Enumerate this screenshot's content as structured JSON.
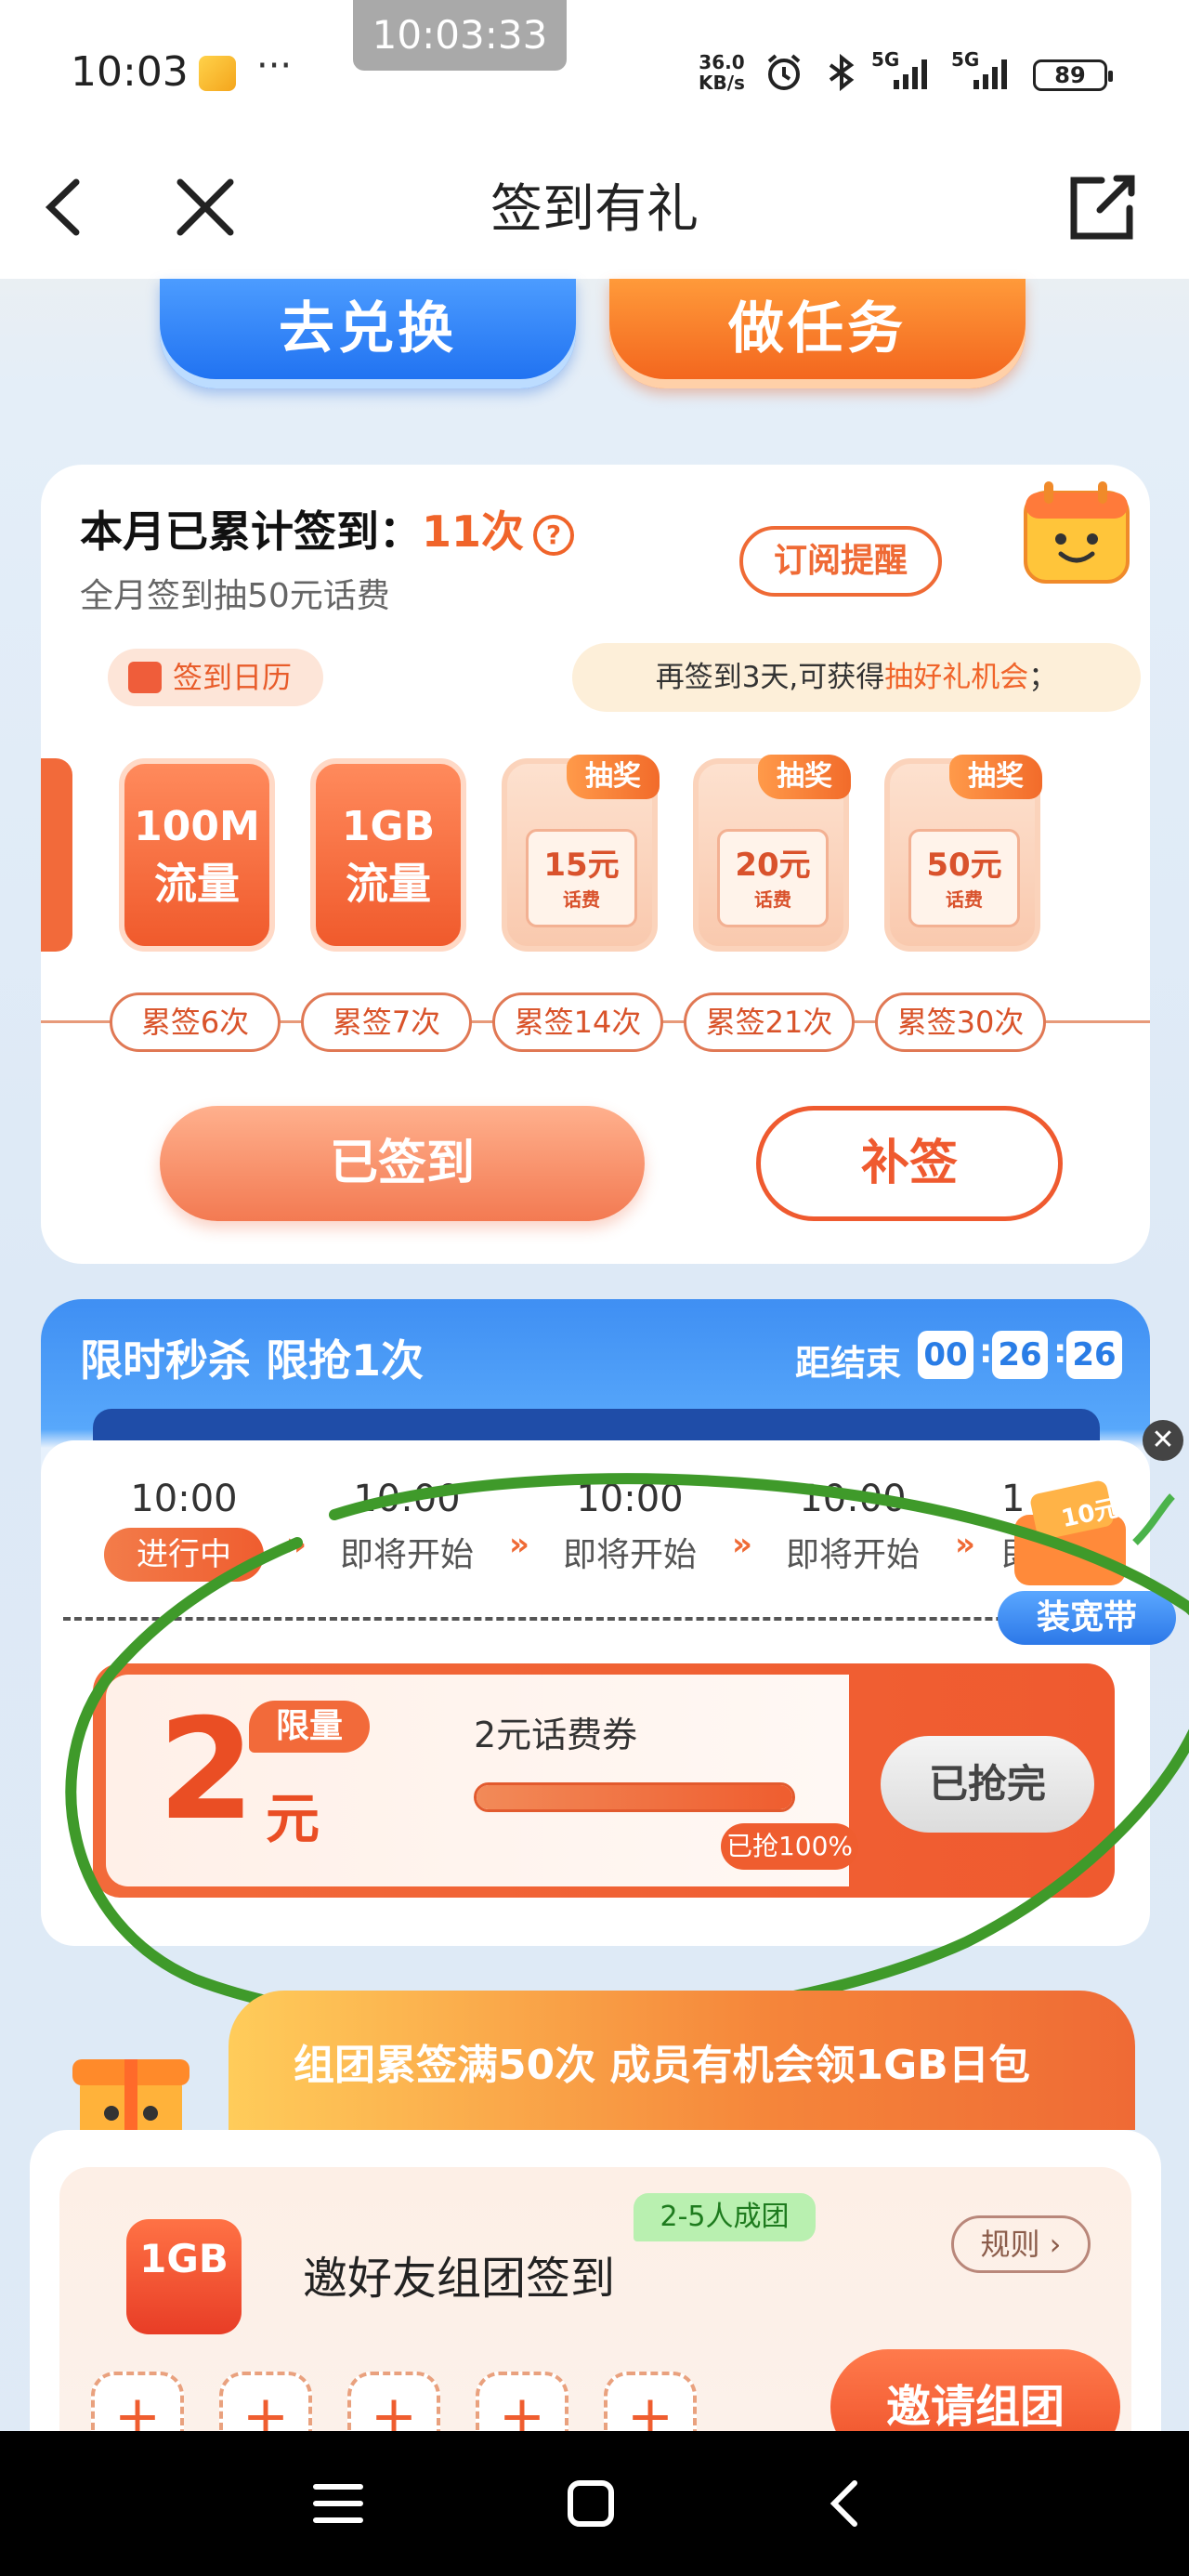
{
  "status_bar": {
    "time": "10:03",
    "more": "···",
    "recording_timer": "10:03:33",
    "net_speed_value": "36.0",
    "net_speed_unit": "KB/s",
    "signal_1": "5G",
    "signal_2": "5G",
    "battery": "89"
  },
  "header": {
    "title": "签到有礼"
  },
  "top_actions": {
    "exchange_label": "去兑换",
    "task_label": "做任务"
  },
  "checkin": {
    "title_prefix": "本月已累计签到：",
    "count": "11次",
    "help_glyph": "?",
    "subtitle": "全月签到抽50元话费",
    "subscribe_label": "订阅提醒",
    "calendar_label": "签到日历",
    "hint_prefix": "再签到3天,可获得",
    "hint_highlight": "抽好礼机会",
    "hint_suffix": "；",
    "rewards": [
      {
        "line1": "100M",
        "line2": "流量",
        "day": "累签6次"
      },
      {
        "line1": "1GB",
        "line2": "流量",
        "day": "累签7次"
      },
      {
        "badge": "抽奖",
        "value": "15元",
        "unit": "话费",
        "day": "累签14次"
      },
      {
        "badge": "抽奖",
        "value": "20元",
        "unit": "话费",
        "day": "累签21次"
      },
      {
        "badge": "抽奖",
        "value": "50元",
        "unit": "话费",
        "day": "累签30次"
      }
    ],
    "signed_label": "已签到",
    "makeup_label": "补签"
  },
  "flash_sale": {
    "title": "限时秒杀  限抢1次",
    "ends_label": "距结束",
    "countdown": [
      "00",
      "26",
      "26"
    ],
    "close_glyph": "✕",
    "slots": [
      {
        "time": "10:00",
        "status": "进行中"
      },
      {
        "time": "10:00",
        "status": "即将开始"
      },
      {
        "time": "10:00",
        "status": "即将开始"
      },
      {
        "time": "10:00",
        "status": "即将开始"
      },
      {
        "time": "1",
        "status": "即"
      }
    ],
    "arrow_glyph": "»",
    "coupon": {
      "amount": "2",
      "unit": "元",
      "limit_tag": "限量",
      "name": "2元话费券",
      "progress": 1.0,
      "progress_label": "已抢100%",
      "button_label": "已抢完"
    },
    "broadband_label": "装宽带",
    "broadband_price": "10元"
  },
  "group": {
    "banner_text": "组团累签满50次 成员有机会领1GB日包",
    "icon_text": "1GB",
    "title": "邀好友组团签到",
    "tag": "2-5人成团",
    "rule_label": "规则 ›",
    "slot_glyph": "+",
    "invite_label": "邀请组团"
  },
  "colors": {
    "accent_orange": "#ef5d2f",
    "accent_blue": "#2a7de6",
    "annotation_green": "#3f9a2a"
  }
}
